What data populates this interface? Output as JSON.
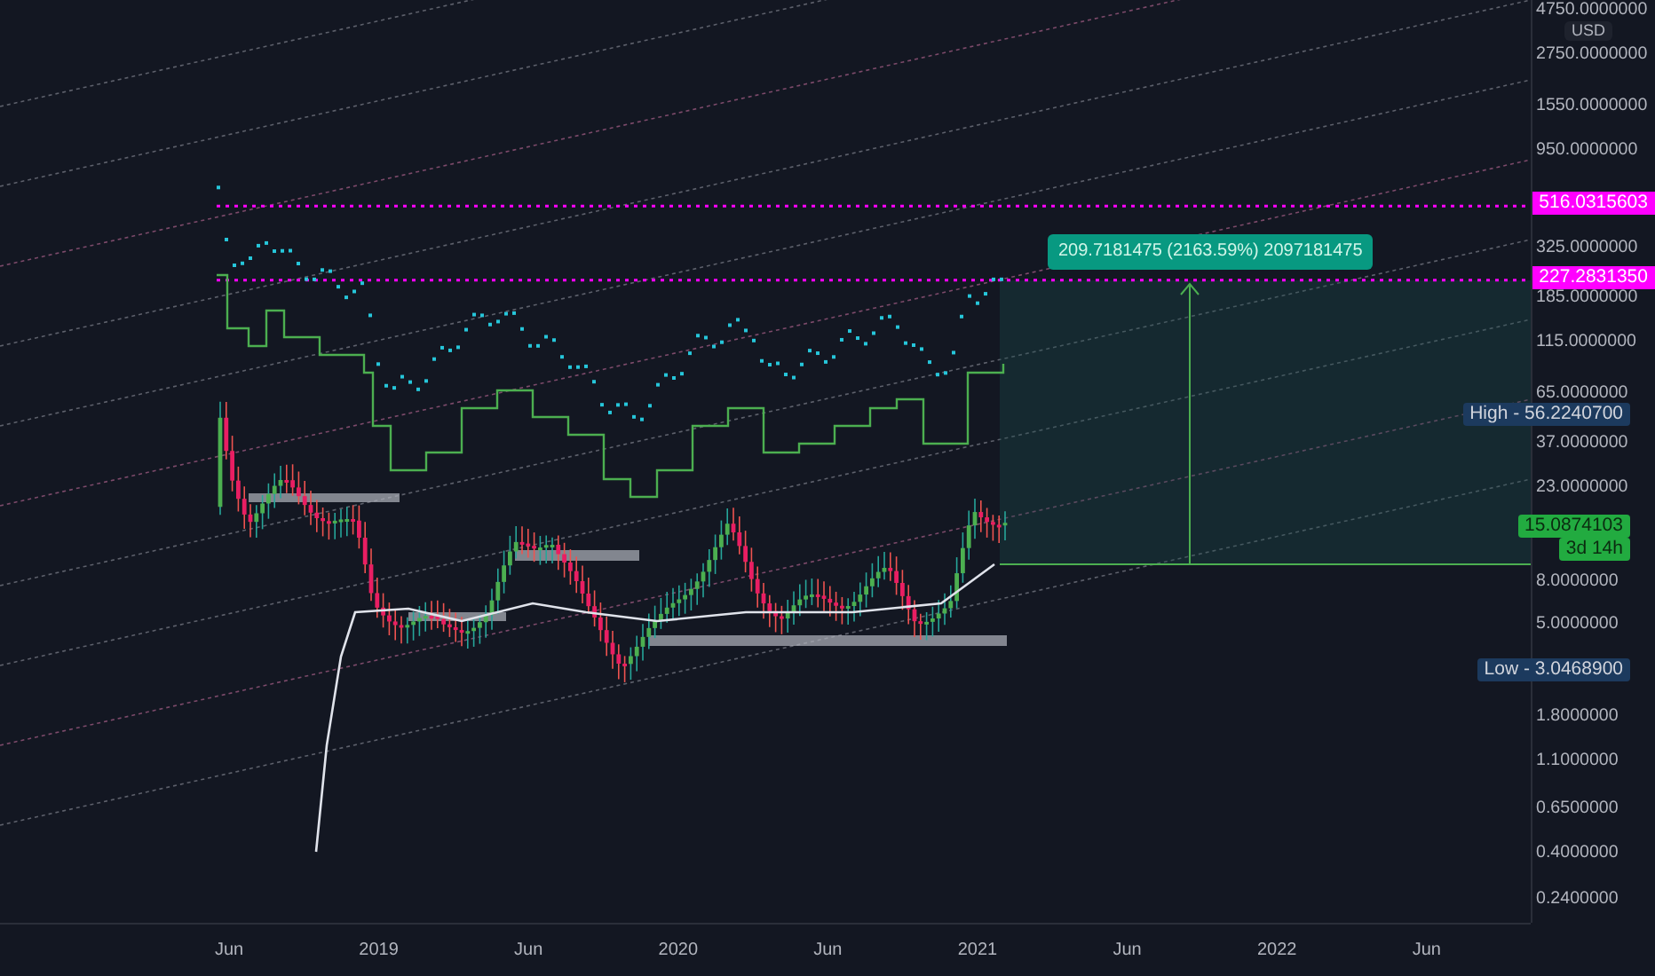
{
  "price_axis": {
    "currency": "USD",
    "ticks": [
      "4750.0000000",
      "2750.0000000",
      "1550.0000000",
      "950.0000000",
      "325.0000000",
      "185.0000000",
      "115.0000000",
      "65.0000000",
      "37.0000000",
      "23.0000000",
      "8.0000000",
      "5.0000000",
      "1.8000000",
      "1.1000000",
      "0.6500000",
      "0.4000000",
      "0.2400000"
    ]
  },
  "time_axis": {
    "ticks": [
      "Jun",
      "2019",
      "Jun",
      "2020",
      "Jun",
      "2021",
      "Jun",
      "2022",
      "Jun"
    ]
  },
  "measure": {
    "text": "209.7181475 (2163.59%) 2097181475"
  },
  "markers": [
    {
      "kind": "line",
      "text": "516.0315603"
    },
    {
      "kind": "line",
      "text": "227.2831350"
    },
    {
      "kind": "high",
      "text": "High - 56.2240700"
    },
    {
      "kind": "current",
      "text": "15.0874103",
      "countdown": "3d 14h"
    },
    {
      "kind": "low",
      "text": "Low - 3.0468900"
    }
  ]
}
